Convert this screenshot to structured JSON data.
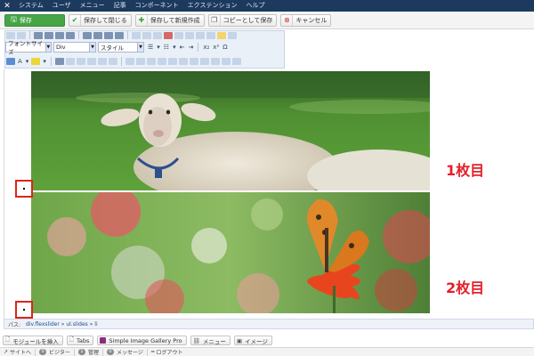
{
  "nav": {
    "logo_icon": "joomla-icon",
    "items": [
      "システム",
      "ユーザ",
      "メニュー",
      "記事",
      "コンポーネント",
      "エクステンション",
      "ヘルプ"
    ]
  },
  "toolbar": {
    "save_label": "保存",
    "save_close_label": "保存して閉じる",
    "save_new_label": "保存して新規作成",
    "save_copy_label": "コピーとして保存",
    "cancel_label": "キャンセル"
  },
  "editor": {
    "font_size_label": "フォントサイズ",
    "format_value": "Div",
    "style_label": "スタイル"
  },
  "content": {
    "slide1_label": "1枚目",
    "slide2_label": "2枚目"
  },
  "pathbar": {
    "label": "パス:",
    "path": "div.flexslider » ul.slides » li"
  },
  "editor_buttons": [
    "モジュールを挿入",
    "Tabs",
    "Simple Image Gallery Pro",
    "メニュー",
    "イメージ"
  ],
  "status": {
    "site_label": "サイトへ",
    "visitors_count": "0",
    "visitors_label": "ビジター",
    "admin_count": "1",
    "admin_label": "管理",
    "messages_count": "0",
    "messages_label": "メッセージ",
    "logout_label": "ログアウト"
  },
  "colors": {
    "navbar": "#1c3a5e",
    "save_button": "#46a546",
    "marker": "#d9261c",
    "slide_label": "#e2202a"
  }
}
